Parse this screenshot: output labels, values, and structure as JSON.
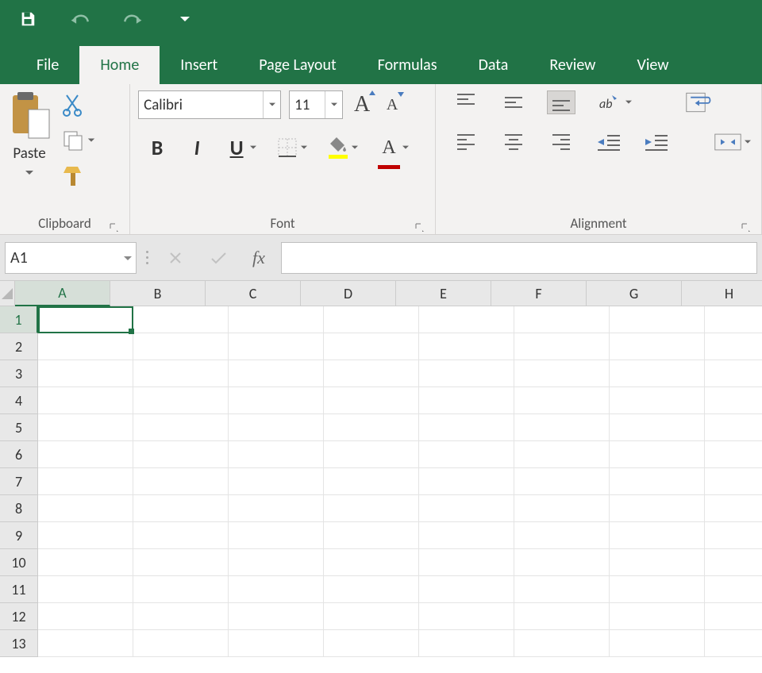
{
  "quick_access": {
    "items": [
      "save",
      "undo",
      "redo",
      "customize"
    ]
  },
  "tabs": {
    "items": [
      {
        "id": "file",
        "label": "File"
      },
      {
        "id": "home",
        "label": "Home",
        "active": true
      },
      {
        "id": "insert",
        "label": "Insert"
      },
      {
        "id": "page-layout",
        "label": "Page Layout"
      },
      {
        "id": "formulas",
        "label": "Formulas"
      },
      {
        "id": "data",
        "label": "Data"
      },
      {
        "id": "review",
        "label": "Review"
      },
      {
        "id": "view",
        "label": "View"
      }
    ]
  },
  "ribbon": {
    "clipboard": {
      "label": "Clipboard",
      "paste_label": "Paste"
    },
    "font": {
      "label": "Font",
      "name": "Calibri",
      "size": "11"
    },
    "alignment": {
      "label": "Alignment"
    }
  },
  "formula_bar": {
    "name_box": "A1",
    "fx_label": "fx",
    "formula_value": ""
  },
  "grid": {
    "columns": [
      "A",
      "B",
      "C",
      "D",
      "E",
      "F",
      "G",
      "H"
    ],
    "rows": [
      "1",
      "2",
      "3",
      "4",
      "5",
      "6",
      "7",
      "8",
      "9",
      "10",
      "11",
      "12",
      "13"
    ],
    "selected_cell": "A1"
  },
  "colors": {
    "accent": "#217346",
    "fill_highlight": "#ffff00",
    "font_color": "#c00000"
  }
}
